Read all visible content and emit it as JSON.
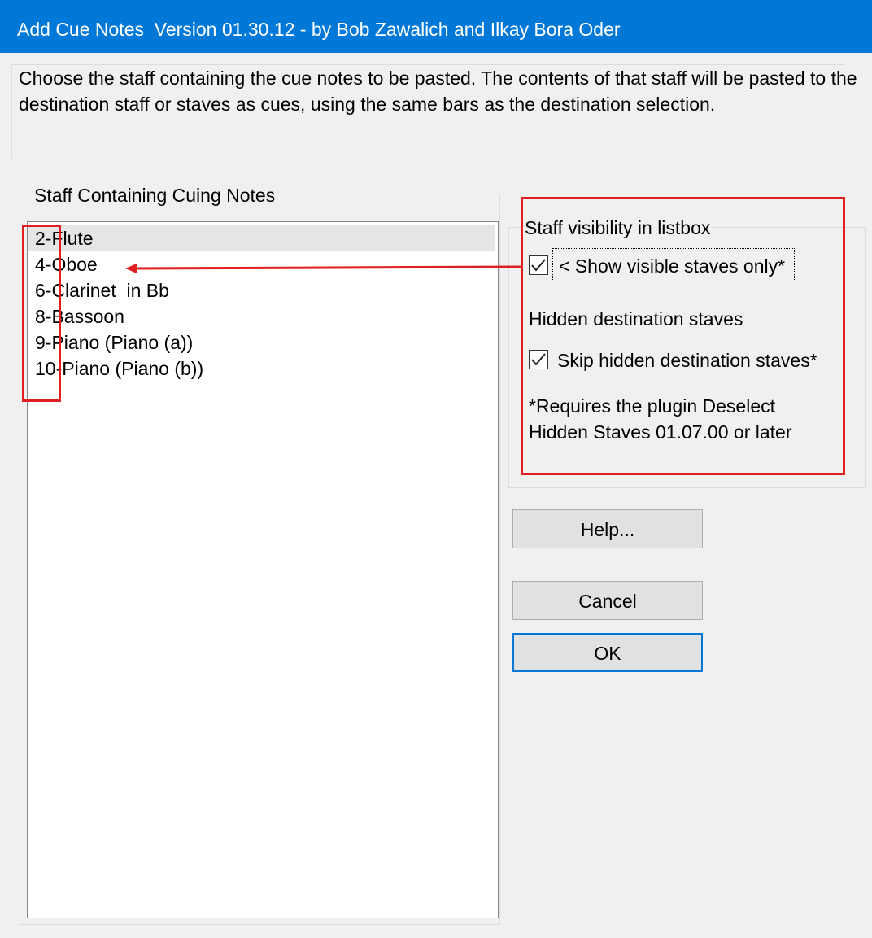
{
  "window": {
    "title": "Add Cue Notes  Version 01.30.12 - by Bob Zawalich and Ilkay Bora Oder"
  },
  "description": "Choose the staff containing the cue notes to be pasted. The contents of that staff will be pasted to the destination staff or staves as cues, using the same bars as the destination selection.",
  "staff_group": {
    "label": "Staff Containing Cuing Notes",
    "items": [
      {
        "label": "2-Flute",
        "selected": true
      },
      {
        "label": "4-Oboe",
        "selected": false
      },
      {
        "label": "6-Clarinet  in Bb",
        "selected": false
      },
      {
        "label": "8-Bassoon",
        "selected": false
      },
      {
        "label": "9-Piano (Piano (a))",
        "selected": false
      },
      {
        "label": "10-Piano (Piano (b))",
        "selected": false
      }
    ]
  },
  "visibility_group": {
    "label": "Staff visibility in listbox",
    "show_visible_checkbox": {
      "label": "< Show visible staves only*",
      "checked": true
    },
    "hidden_label": "Hidden destination staves",
    "skip_hidden_checkbox": {
      "label": "Skip hidden destination staves*",
      "checked": true
    },
    "note_line1": "*Requires the plugin Deselect",
    "note_line2": "Hidden Staves 01.07.00 or later"
  },
  "buttons": {
    "help": "Help...",
    "cancel": "Cancel",
    "ok": "OK"
  },
  "colors": {
    "titlebar": "#0078d7",
    "annotation": "#e02020",
    "default_button_border": "#0078d7"
  }
}
